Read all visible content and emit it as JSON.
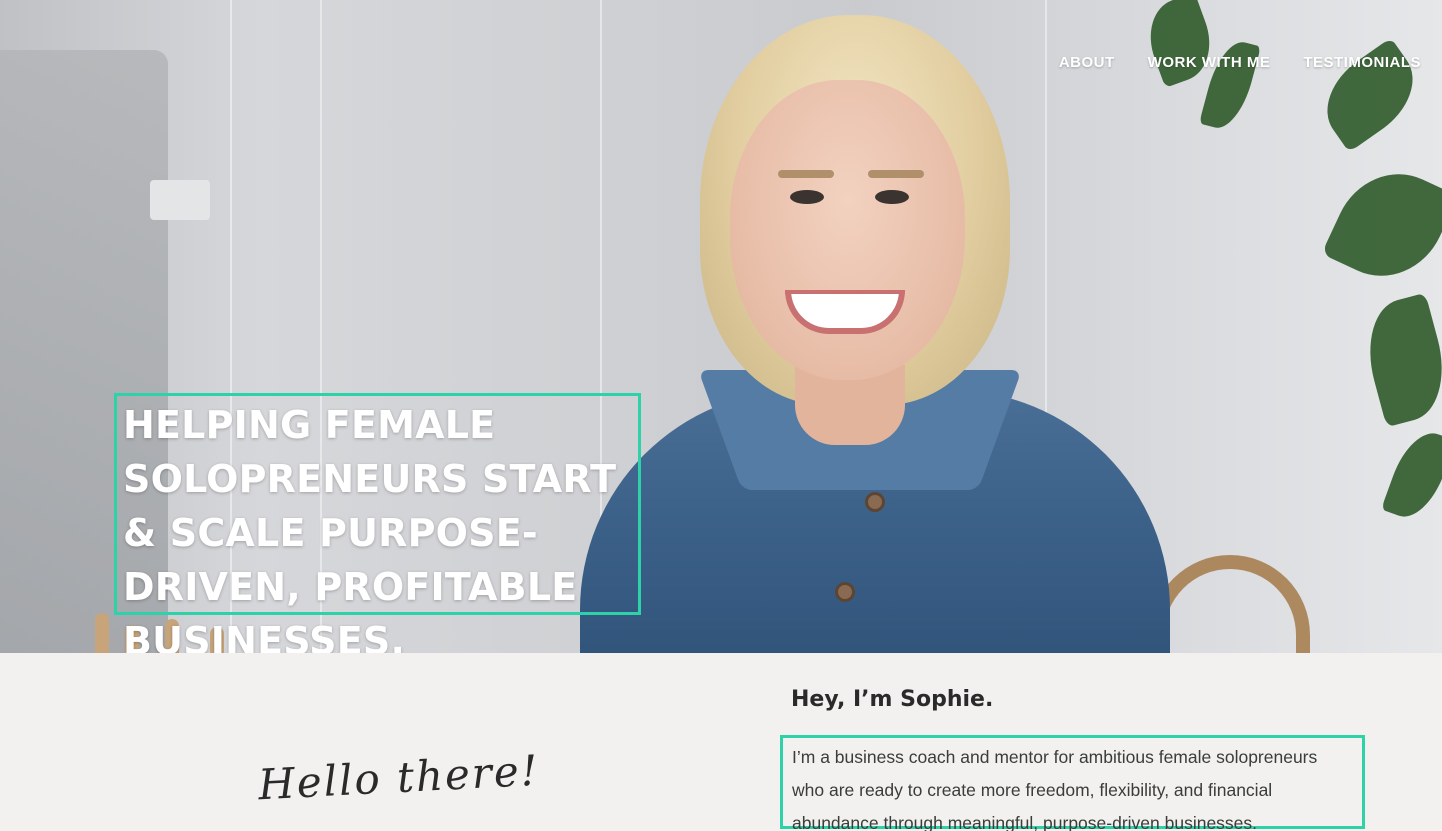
{
  "nav": {
    "items": [
      "ABOUT",
      "WORK WITH ME",
      "TESTIMONIALS"
    ]
  },
  "hero": {
    "headline": "HELPING FEMALE SOLOPRENEURS START & SCALE PURPOSE-DRIVEN, PROFITABLE BUSINESSES."
  },
  "intro": {
    "script_greeting": "Hello there!",
    "title": "Hey, I’m Sophie.",
    "body": "I’m a business coach and mentor for ambitious female solopreneurs who are ready to create more freedom, flexibility, and financial abundance through meaningful, purpose-driven businesses."
  },
  "colors": {
    "accent": "#2ed2a8",
    "background": "#f2f1ef",
    "text": "#2a2a2a"
  },
  "icons": []
}
